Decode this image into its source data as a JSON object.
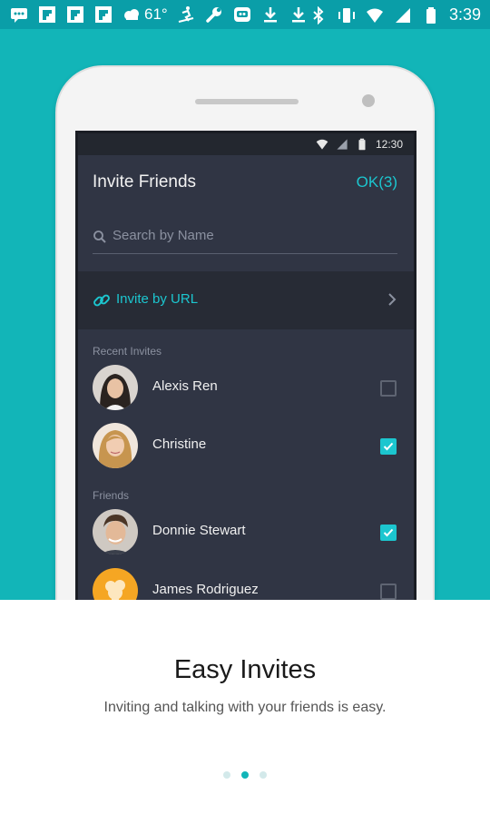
{
  "status_bar": {
    "temperature": "61°",
    "time": "3:39",
    "left_icons": [
      "message-icon",
      "flipboard-icon",
      "flipboard-icon",
      "flipboard-icon",
      "weather-cloud-icon",
      "skier-icon",
      "wrench-icon",
      "app-icon",
      "download-icon",
      "download-icon"
    ],
    "right_icons": [
      "bluetooth-icon",
      "vibrate-icon",
      "wifi-icon",
      "signal-icon",
      "battery-icon"
    ]
  },
  "phone_screen": {
    "status_time": "12:30",
    "header": {
      "title": "Invite Friends",
      "ok_label": "OK(3)"
    },
    "search": {
      "placeholder": "Search by Name"
    },
    "invite_url": {
      "label": "Invite by URL"
    },
    "sections": [
      {
        "label": "Recent Invites",
        "contacts": [
          {
            "name": "Alexis Ren",
            "checked": false
          },
          {
            "name": "Christine",
            "checked": true
          }
        ]
      },
      {
        "label": "Friends",
        "contacts": [
          {
            "name": "Donnie Stewart",
            "checked": true
          },
          {
            "name": "James Rodriguez",
            "checked": false
          }
        ]
      }
    ]
  },
  "caption": {
    "title": "Easy Invites",
    "subtitle": "Inviting and talking with your friends is easy."
  },
  "pager": {
    "count": 3,
    "active_index": 1
  },
  "colors": {
    "hero": "#12b5b8",
    "accent": "#1cc6cf",
    "status_bar": "#0a9ea8",
    "app_bg": "#303544"
  }
}
